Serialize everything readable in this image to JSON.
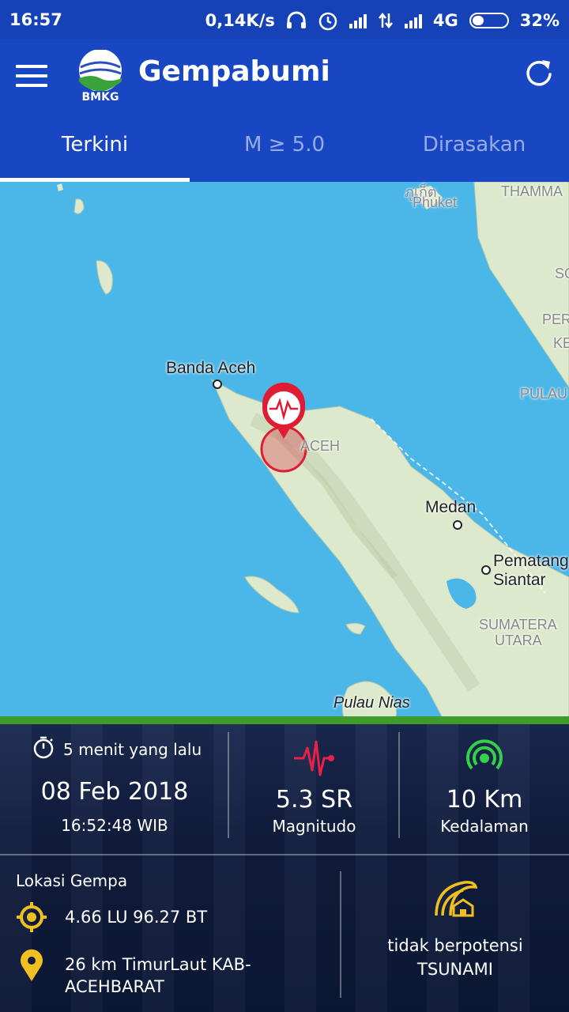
{
  "status_bar": {
    "time": "16:57",
    "speed": "0,14K/s",
    "network": "4G",
    "battery": "32%",
    "battery_level": 0.32
  },
  "app_bar": {
    "logo_text": "BMKG",
    "title": "Gempabumi"
  },
  "tabs": [
    {
      "label": "Terkini",
      "active": true
    },
    {
      "label": "M ≥ 5.0",
      "active": false
    },
    {
      "label": "Dirasakan",
      "active": false
    }
  ],
  "map": {
    "labels": {
      "phuket_thai": "ภูเก็ต",
      "phuket": "Phuket",
      "thamma": "THAMMA",
      "so": "SO",
      "per": "PER",
      "ke": "KE",
      "pulau": "PULAU",
      "banda_aceh": "Banda Aceh",
      "aceh": "ACEH",
      "medan": "Medan",
      "pematang": "Pematang",
      "siantar": "Siantar",
      "sumatera": "SUMATERA",
      "utara": "UTARA",
      "pulau_nias": "Pulau Nias"
    }
  },
  "info": {
    "time_ago": "5 menit yang lalu",
    "date": "08 Feb 2018",
    "time": "16:52:48 WIB",
    "magnitude_value": "5.3 SR",
    "magnitude_label": "Magnitudo",
    "depth_value": "10 Km",
    "depth_label": "Kedalaman",
    "location_title": "Lokasi Gempa",
    "coordinates": "4.66 LU 96.27 BT",
    "region_line1": "26 km TimurLaut KAB-",
    "region_line2": "ACEHBARAT",
    "tsunami_line1": "tidak berpotensi",
    "tsunami_line2": "TSUNAMI"
  },
  "colors": {
    "status_bar": "#1642b8",
    "app_bar": "#1947c4",
    "sea": "#4bb6e8",
    "land": "#dce9cc",
    "marker": "#e01c34",
    "wave": "#e8204a",
    "depth": "#34d04a",
    "location_icon": "#f0c020",
    "green_strip": "#3f9c2c"
  }
}
